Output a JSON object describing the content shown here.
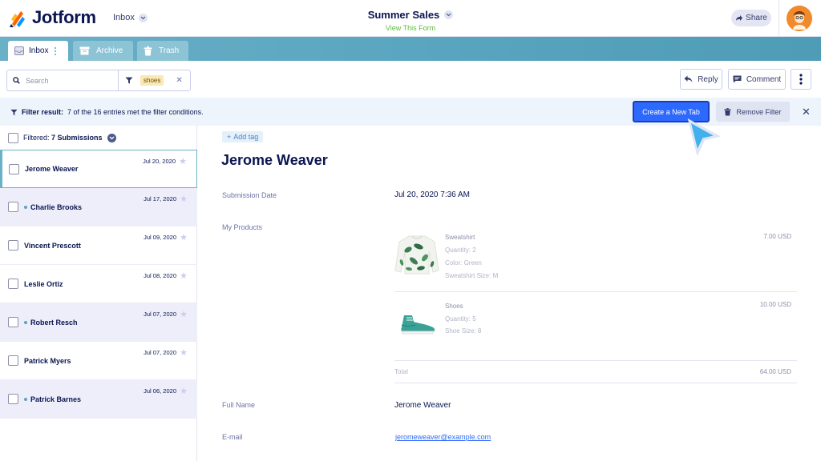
{
  "header": {
    "logo_text": "Jotform",
    "inbox_label": "Inbox",
    "form_title": "Summer Sales",
    "view_form_link": "View This Form",
    "share_label": "Share"
  },
  "tabs": [
    {
      "label": "Inbox",
      "icon": "inbox-icon"
    },
    {
      "label": "Archive",
      "icon": "archive-icon"
    },
    {
      "label": "Trash",
      "icon": "trash-icon"
    }
  ],
  "search": {
    "placeholder": "Search",
    "filter_chip": "shoes"
  },
  "actions": {
    "reply_label": "Reply",
    "comment_label": "Comment"
  },
  "filter_bar": {
    "prefix": "Filter result:",
    "message": "7 of the 16 entries met the filter conditions.",
    "create_tab_label": "Create a New Tab",
    "remove_filter_label": "Remove Filter"
  },
  "list": {
    "header_prefix": "Filtered:",
    "header_count": "7 Submissions",
    "rows": [
      {
        "name": "Jerome Weaver",
        "date": "Jul 20, 2020",
        "state": "selected"
      },
      {
        "name": "Charlie Brooks",
        "date": "Jul 17, 2020",
        "state": "unread"
      },
      {
        "name": "Vincent Prescott",
        "date": "Jul 09, 2020",
        "state": "read"
      },
      {
        "name": "Leslie Ortiz",
        "date": "Jul 08, 2020",
        "state": "read"
      },
      {
        "name": "Robert Resch",
        "date": "Jul 07, 2020",
        "state": "unread"
      },
      {
        "name": "Patrick Myers",
        "date": "Jul 07, 2020",
        "state": "read"
      },
      {
        "name": "Patrick Barnes",
        "date": "Jul 06, 2020",
        "state": "unread"
      }
    ]
  },
  "detail": {
    "add_tag_label": "Add tag",
    "name": "Jerome Weaver",
    "submission_date_label": "Submission Date",
    "submission_date_value": "Jul 20, 2020 7:36 AM",
    "products_label": "My Products",
    "products": [
      {
        "title": "Sweatshirt",
        "lines": [
          "Quantity: 2",
          "Color: Green",
          "Sweatshirt Size: M"
        ],
        "price": "7.00 USD"
      },
      {
        "title": "Shoes",
        "lines": [
          "Quantity: 5",
          "Shoe Size: 8"
        ],
        "price": "10.00 USD"
      }
    ],
    "total_label": "Total",
    "total_value": "64.00 USD",
    "full_name_label": "Full Name",
    "full_name_value": "Jerome Weaver",
    "email_label": "E-mail",
    "email_value": "jeromeweaver@example.com"
  },
  "colors": {
    "accent": "#2e69ff",
    "navy": "#0a1551",
    "teal": "#5aa5bf",
    "unread_row": "#edeefa",
    "filter_bar": "#edf4fb"
  }
}
